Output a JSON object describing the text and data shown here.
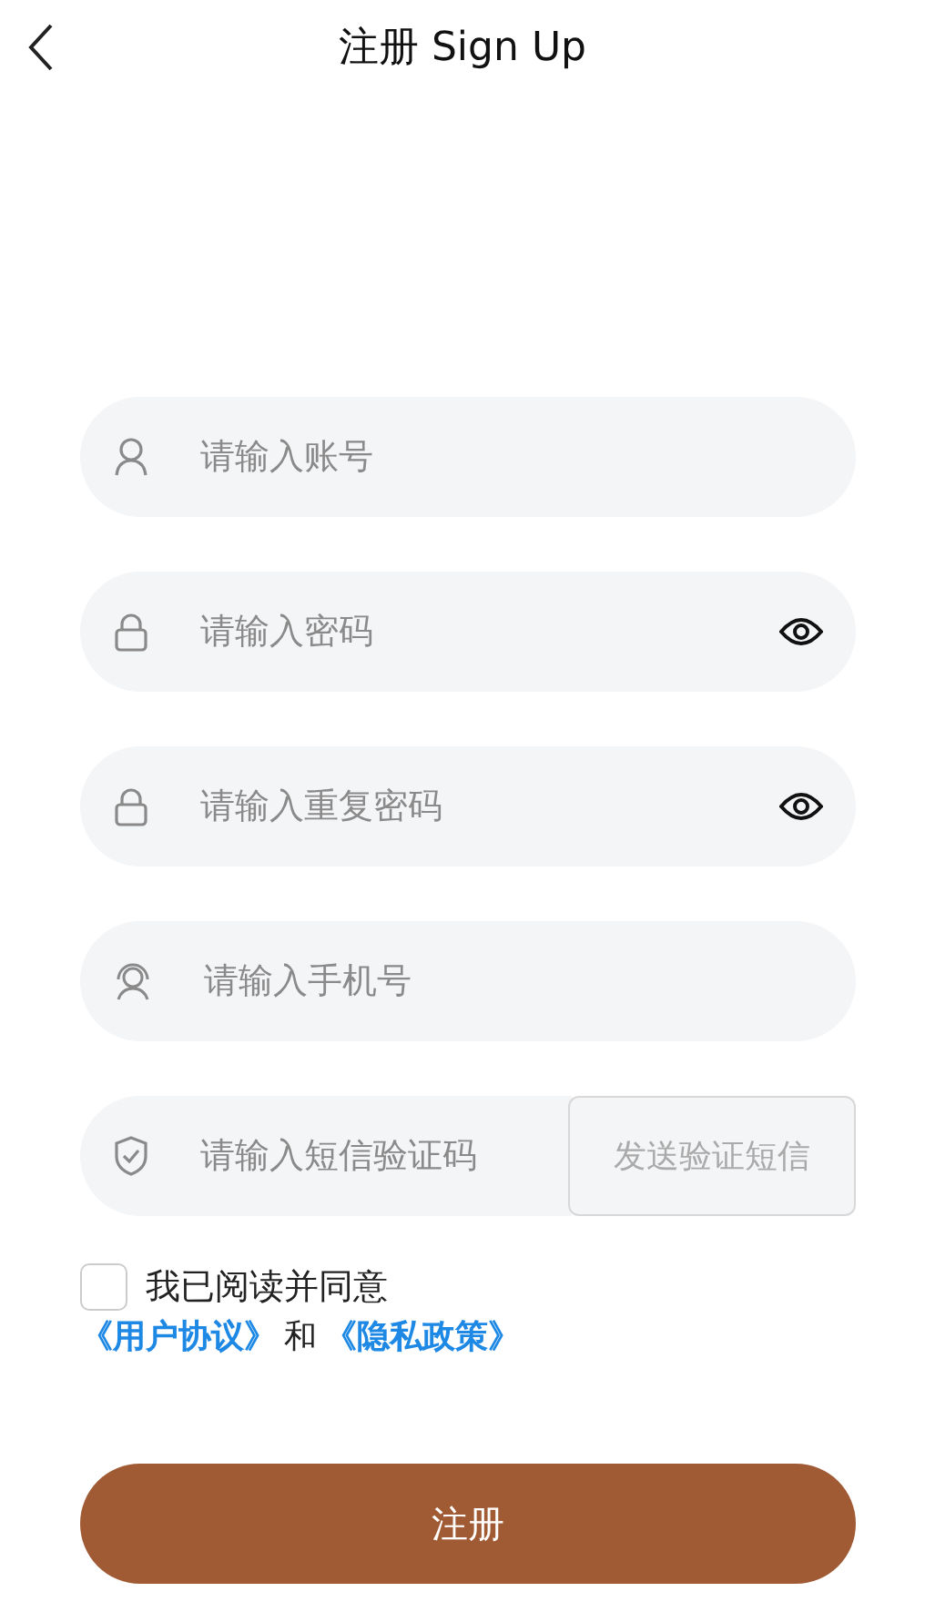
{
  "header": {
    "title": "注册 Sign Up"
  },
  "fields": [
    {
      "kind": "user",
      "placeholder": "请输入账号",
      "eye": false
    },
    {
      "kind": "lock",
      "placeholder": "请输入密码",
      "eye": true
    },
    {
      "kind": "lock",
      "placeholder": "请输入重复密码",
      "eye": true
    },
    {
      "kind": "phone",
      "placeholder": "请输入手机号",
      "eye": false
    },
    {
      "kind": "shield",
      "placeholder": "请输入短信验证码",
      "eye": false,
      "action": "发送验证短信"
    }
  ],
  "agreement": {
    "checked": false,
    "text": "我已阅读并同意",
    "link_1": "《用户协议》",
    "joiner": "和",
    "link_2": "《隐私政策》"
  },
  "submit": "注册"
}
